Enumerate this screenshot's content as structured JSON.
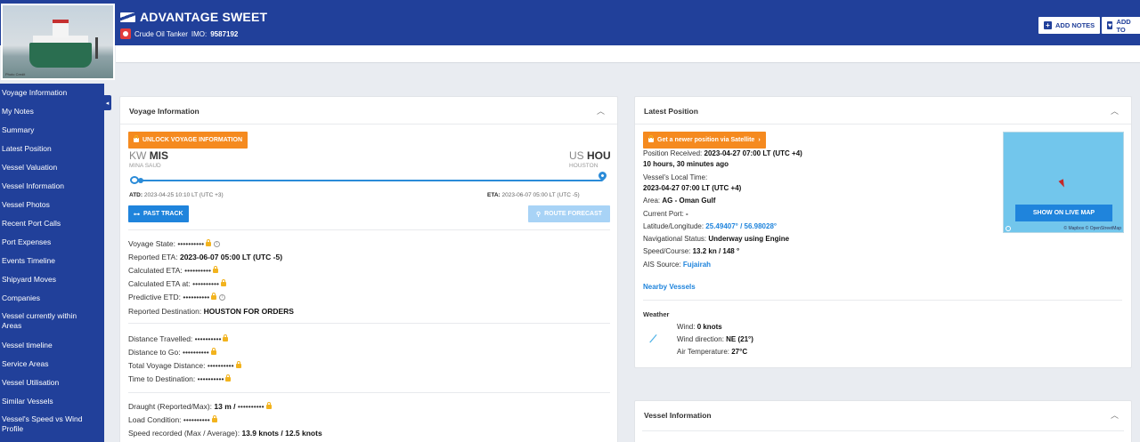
{
  "header": {
    "vessel_name": "ADVANTAGE SWEET",
    "vessel_type": "Crude Oil Tanker",
    "imo_label": "IMO:",
    "imo_value": "9587192",
    "photo_credit": "Photo Credit",
    "add_notes_label": "ADD NOTES",
    "add_to_label": "ADD TO",
    "colors": {
      "primary": "#21409a",
      "accent": "#f58a1f",
      "link": "#1f84dc"
    }
  },
  "sidebar": {
    "items": [
      "Voyage Information",
      "My Notes",
      "Summary",
      "Latest Position",
      "Vessel Valuation",
      "Vessel Information",
      "Vessel Photos",
      "Recent Port Calls",
      "Port Expenses",
      "Events Timeline",
      "Shipyard Moves",
      "Companies",
      "Vessel currently within Areas",
      "Vessel timeline",
      "Service Areas",
      "Vessel Utilisation",
      "Similar Vessels",
      "Vessel's Speed vs Wind Profile"
    ]
  },
  "voyage": {
    "title": "Voyage Information",
    "unlock_label": "UNLOCK VOYAGE INFORMATION",
    "origin": {
      "country": "KW",
      "code": "MIS",
      "name": "MINA SAUD"
    },
    "destination": {
      "country": "US",
      "code": "HOU",
      "name": "HOUSTON"
    },
    "atd_label": "ATD:",
    "atd_value": "2023-04-25 10:10 LT (UTC +3)",
    "eta_label": "ETA:",
    "eta_value": "2023-06-07 05:00 LT (UTC -5)",
    "past_track_label": "PAST TRACK",
    "route_forecast_label": "ROUTE FORECAST",
    "masked": "••••••••••",
    "rows": {
      "voyage_state": "Voyage State:",
      "reported_eta": "Reported ETA:",
      "reported_eta_value": "2023-06-07 05:00 LT (UTC -5)",
      "calculated_eta": "Calculated ETA:",
      "calculated_eta_at": "Calculated ETA at:",
      "predictive_etd": "Predictive ETD:",
      "reported_destination": "Reported Destination:",
      "reported_destination_value": "HOUSTON FOR ORDERS",
      "distance_travelled": "Distance Travelled:",
      "distance_to_go": "Distance to Go:",
      "total_voyage_distance": "Total Voyage Distance:",
      "time_to_destination": "Time to Destination:",
      "draught": "Draught (Reported/Max):",
      "draught_value": "13 m /",
      "load_condition": "Load Condition:",
      "speed_recorded": "Speed recorded (Max / Average):",
      "speed_recorded_value": "13.9 knots / 12.5 knots"
    }
  },
  "latest_position": {
    "title": "Latest Position",
    "satellite_label": "Get a newer position via Satellite",
    "position_received_label": "Position Received:",
    "position_received_value": "2023-04-27 07:00 LT (UTC +4)",
    "ago": "10 hours, 30 minutes ago",
    "local_time_label": "Vessel's Local Time:",
    "local_time_value": "2023-04-27 07:00 LT (UTC +4)",
    "area_label": "Area:",
    "area_value": "AG - Oman Gulf",
    "current_port_label": "Current Port:",
    "current_port_value": "-",
    "latlon_label": "Latitude/Longitude:",
    "latlon_value": "25.49407° / 56.98028°",
    "nav_status_label": "Navigational Status:",
    "nav_status_value": "Underway using Engine",
    "speed_course_label": "Speed/Course:",
    "speed_course_value": "13.2 kn / 148 °",
    "ais_source_label": "AIS Source:",
    "ais_source_value": "Fujairah",
    "nearby_label": "Nearby Vessels",
    "show_live_map_label": "SHOW ON LIVE MAP",
    "map_attribution": "© Mapbox © OpenStreetMap",
    "weather": {
      "title": "Weather",
      "wind_label": "Wind:",
      "wind_value": "0 knots",
      "wind_dir_label": "Wind direction:",
      "wind_dir_value": "NE (21°)",
      "air_temp_label": "Air Temperature:",
      "air_temp_value": "27°C"
    }
  },
  "vessel_info": {
    "title": "Vessel Information"
  }
}
